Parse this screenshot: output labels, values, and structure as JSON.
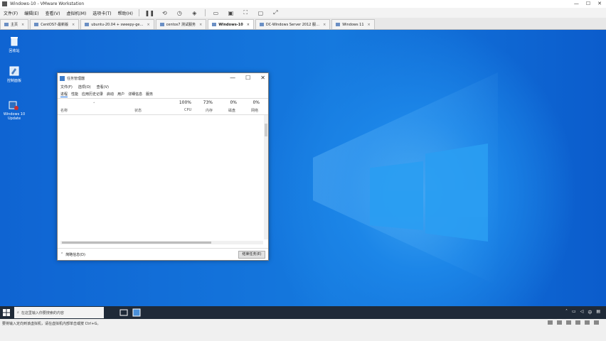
{
  "vmware": {
    "title": "Windows-10 - VMware Workstation",
    "menu": [
      "文件(F)",
      "编辑(E)",
      "查看(V)",
      "虚拟机(M)",
      "选项卡(T)",
      "帮助(H)"
    ],
    "tabs": [
      {
        "label": "主页",
        "active": false
      },
      {
        "label": "CentOS7-最新版",
        "active": false
      },
      {
        "label": "ubuntu-20.04 + sweepy-ge…",
        "active": false
      },
      {
        "label": "centos7 测试服务",
        "active": false
      },
      {
        "label": "Windows-10",
        "active": true
      },
      {
        "label": "DC-Windows Server 2012 服…",
        "active": false
      },
      {
        "label": "Windows 11",
        "active": false
      }
    ],
    "status_message": "要将输入定向到该虚拟机，请在虚拟机内部单击或按 Ctrl+G。"
  },
  "desktop": {
    "icons": [
      {
        "label": "回收站",
        "icon": "recycle-bin-icon"
      },
      {
        "label": "控制面板",
        "icon": "control-panel-icon"
      },
      {
        "label": "Windows 10 Update",
        "icon": "update-icon"
      }
    ]
  },
  "task_manager": {
    "title": "任务管理器",
    "menu": [
      "文件(F)",
      "选项(O)",
      "查看(V)"
    ],
    "tabs": [
      "进程",
      "性能",
      "应用历史记录",
      "启动",
      "用户",
      "详细信息",
      "服务"
    ],
    "active_tab": "进程",
    "columns": {
      "name": "名称",
      "status": "状态",
      "cpu": {
        "value": "100%",
        "label": "CPU"
      },
      "memory": {
        "value": "73%",
        "label": "内存"
      },
      "disk": {
        "value": "0%",
        "label": "磁盘"
      },
      "network": {
        "value": "0%",
        "label": "网络"
      }
    },
    "footer": {
      "fewer_details": "简略信息(D)",
      "end_task": "结束任务(E)"
    }
  },
  "taskbar": {
    "search_placeholder": "在这里输入你要搜索的内容"
  },
  "colors": {
    "desktop": "#1579de",
    "taskbar": "#1f2a38",
    "accent": "#1a73e8"
  }
}
